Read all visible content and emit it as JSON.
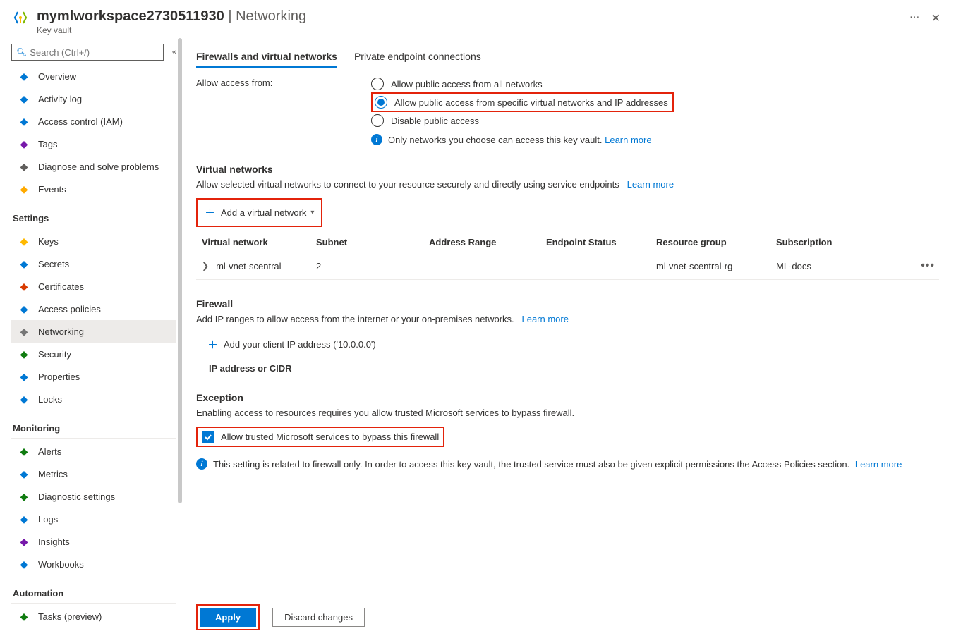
{
  "header": {
    "title_main": "mymlworkspace2730511930",
    "title_sub": "Networking",
    "resource_type": "Key vault",
    "more": "…",
    "close": "✕"
  },
  "sidebar": {
    "search_placeholder": "Search (Ctrl+/)",
    "items_top": [
      {
        "label": "Overview",
        "icon": "globe-icon",
        "color": "#0078d4"
      },
      {
        "label": "Activity log",
        "icon": "log-icon",
        "color": "#0078d4"
      },
      {
        "label": "Access control (IAM)",
        "icon": "iam-icon",
        "color": "#0078d4"
      },
      {
        "label": "Tags",
        "icon": "tags-icon",
        "color": "#7719aa"
      },
      {
        "label": "Diagnose and solve problems",
        "icon": "wrench-icon",
        "color": "#605e5c"
      },
      {
        "label": "Events",
        "icon": "events-icon",
        "color": "#ffaa00"
      }
    ],
    "section_settings": "Settings",
    "items_settings": [
      {
        "label": "Keys",
        "icon": "key-icon",
        "color": "#ffb900"
      },
      {
        "label": "Secrets",
        "icon": "secret-icon",
        "color": "#0078d4"
      },
      {
        "label": "Certificates",
        "icon": "cert-icon",
        "color": "#d83b01"
      },
      {
        "label": "Access policies",
        "icon": "policies-icon",
        "color": "#0078d4"
      },
      {
        "label": "Networking",
        "icon": "net-icon",
        "active": true,
        "color": "#767676"
      },
      {
        "label": "Security",
        "icon": "shield-icon",
        "color": "#107c10"
      },
      {
        "label": "Properties",
        "icon": "props-icon",
        "color": "#0078d4"
      },
      {
        "label": "Locks",
        "icon": "lock-icon",
        "color": "#0078d4"
      }
    ],
    "section_monitoring": "Monitoring",
    "items_monitoring": [
      {
        "label": "Alerts",
        "icon": "alert-icon",
        "color": "#107c10"
      },
      {
        "label": "Metrics",
        "icon": "metrics-icon",
        "color": "#0078d4"
      },
      {
        "label": "Diagnostic settings",
        "icon": "diag-icon",
        "color": "#107c10"
      },
      {
        "label": "Logs",
        "icon": "logs-icon",
        "color": "#0078d4"
      },
      {
        "label": "Insights",
        "icon": "insights-icon",
        "color": "#7719aa"
      },
      {
        "label": "Workbooks",
        "icon": "workbooks-icon",
        "color": "#0078d4"
      }
    ],
    "section_automation": "Automation",
    "items_automation": [
      {
        "label": "Tasks (preview)",
        "icon": "tasks-icon",
        "color": "#107c10"
      }
    ]
  },
  "tabs": {
    "firewalls": "Firewalls and virtual networks",
    "private": "Private endpoint connections"
  },
  "access": {
    "label": "Allow access from:",
    "opt_all": "Allow public access from all networks",
    "opt_specific": "Allow public access from specific virtual networks and IP addresses",
    "opt_disable": "Disable public access",
    "info_text": "Only networks you choose can access this key vault.",
    "learn_more": "Learn more"
  },
  "vnets": {
    "heading": "Virtual networks",
    "desc": "Allow selected virtual networks to connect to your resource securely and directly using service endpoints",
    "learn_more": "Learn more",
    "add_btn": "Add a virtual network",
    "cols": {
      "net": "Virtual network",
      "sub": "Subnet",
      "addr": "Address Range",
      "ep": "Endpoint Status",
      "rg": "Resource group",
      "subsc": "Subscription"
    },
    "row": {
      "net": "ml-vnet-scentral",
      "sub": "2",
      "addr": "",
      "ep": "",
      "rg": "ml-vnet-scentral-rg",
      "subsc": "ML-docs"
    }
  },
  "firewall": {
    "heading": "Firewall",
    "desc": "Add IP ranges to allow access from the internet or your on-premises networks.",
    "learn_more": "Learn more",
    "add_client": "Add your client IP address ('10.0.0.0')",
    "ip_label": "IP address or CIDR"
  },
  "exception": {
    "heading": "Exception",
    "desc": "Enabling access to resources requires you allow trusted Microsoft services to bypass firewall.",
    "checkbox": "Allow trusted Microsoft services to bypass this firewall",
    "info": "This setting is related to firewall only. In order to access this key vault, the trusted service must also be given explicit permissions the Access Policies section.",
    "learn_more": "Learn more"
  },
  "footer": {
    "apply": "Apply",
    "discard": "Discard changes"
  }
}
